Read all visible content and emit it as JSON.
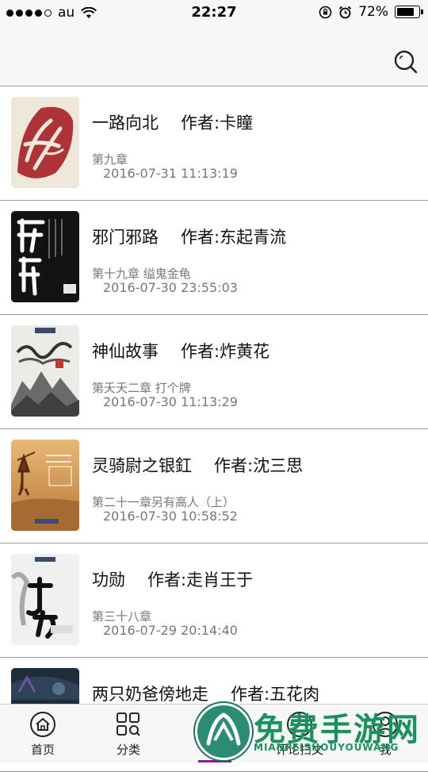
{
  "status_bar": {
    "carrier": "au",
    "time": "22:27",
    "battery": "72%",
    "battery_level": 0.72
  },
  "books": [
    {
      "title": "一路向北",
      "author": "作者:卡瞳",
      "chapter": "第九章",
      "date": "2016-07-31 11:13:19",
      "cover": {
        "bg": "#f1ebe1",
        "accent": "#b8262b",
        "icon": "red-seal-calligraphy"
      }
    },
    {
      "title": "邪门邪路",
      "author": "作者:东起青流",
      "chapter": "第十九章 缢鬼金龟",
      "date": "2016-07-30 23:55:03",
      "cover": {
        "bg": "#111111",
        "accent": "#ffffff",
        "icon": "black-calligraphy"
      }
    },
    {
      "title": "神仙故事",
      "author": "作者:炸黄花",
      "chapter": "第夭夭二章 打个牌",
      "date": "2016-07-30 11:13:29",
      "cover": {
        "bg": "#e9e7e3",
        "accent": "#555555",
        "icon": "ink-mountain"
      }
    },
    {
      "title": "灵骑尉之银釭",
      "author": "作者:沈三思",
      "chapter": "第二十一章另有高人（上）",
      "date": "2016-07-30 10:58:52",
      "cover": {
        "bg": "#d9a15a",
        "accent": "#7a3e16",
        "icon": "desert-rider"
      }
    },
    {
      "title": "功勋",
      "author": "作者:走肖王于",
      "chapter": "第三十八章",
      "date": "2016-07-29 20:14:40",
      "cover": {
        "bg": "#efefef",
        "accent": "#222222",
        "icon": "ink-calligraphy"
      }
    },
    {
      "title": "两只奶爸傍地走",
      "author": "作者:五花肉",
      "chapter": "",
      "date": "",
      "cover": {
        "bg": "#1c2a3a",
        "accent": "#7a4aa8",
        "icon": "dark-scene"
      }
    }
  ],
  "tabs": [
    {
      "label": "首页",
      "icon": "home-icon"
    },
    {
      "label": "分类",
      "icon": "category-search-icon"
    },
    {
      "label": "评论扫文",
      "icon": "comment-icon"
    },
    {
      "label": "我",
      "icon": "user-icon"
    }
  ],
  "watermark": {
    "text": "免费手游网",
    "sub": "MIANFEISHOUYOUWANG",
    "color": "#19925f"
  }
}
